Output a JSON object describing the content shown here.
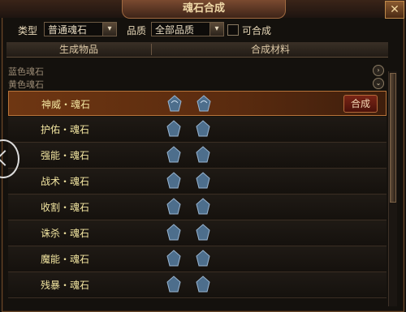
{
  "window": {
    "title": "魂石合成",
    "close_icon": "close-icon"
  },
  "filters": {
    "type_label": "类型",
    "type_value": "普通魂石",
    "quality_label": "品质",
    "quality_value": "全部品质",
    "craftable_label": "可合成"
  },
  "columns": {
    "generated": "生成物品",
    "materials": "合成材料"
  },
  "categories": [
    {
      "label": "蓝色魂石",
      "state": "collapsed"
    },
    {
      "label": "黄色魂石",
      "state": "expanded"
    }
  ],
  "rows": [
    {
      "name": "神威・魂石",
      "button": "合成",
      "selected": true
    },
    {
      "name": "护佑・魂石"
    },
    {
      "name": "强能・魂石"
    },
    {
      "name": "战术・魂石"
    },
    {
      "name": "收割・魂石"
    },
    {
      "name": "诛杀・魂石"
    },
    {
      "name": "魔能・魂石"
    },
    {
      "name": "残暴・魂石"
    }
  ],
  "colors": {
    "accent": "#b8743a",
    "row_text": "#f3e6a1",
    "button": "#7a2616"
  }
}
